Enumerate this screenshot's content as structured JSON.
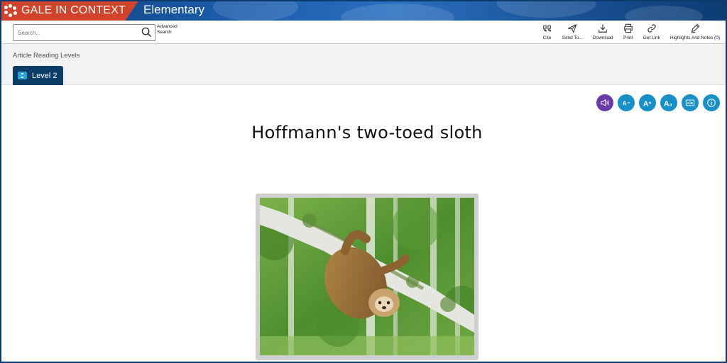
{
  "header": {
    "brand": "GALE IN CONTEXT",
    "product": "Elementary"
  },
  "toolbar": {
    "search_placeholder": "Search...",
    "advanced_search": "Advanced Search",
    "tools": [
      {
        "label": "Cite",
        "icon": "quote-icon"
      },
      {
        "label": "Send To...",
        "icon": "send-icon"
      },
      {
        "label": "Download",
        "icon": "download-icon"
      },
      {
        "label": "Print",
        "icon": "print-icon"
      },
      {
        "label": "Get Link",
        "icon": "link-icon"
      },
      {
        "label": "Highlights And Notes (0)",
        "icon": "pencil-icon"
      }
    ]
  },
  "reading_levels": {
    "title": "Article Reading Levels",
    "current": "Level 2"
  },
  "reader_controls": [
    {
      "name": "listen",
      "icon": "speaker-icon",
      "color": "#6a3aa8"
    },
    {
      "name": "decrease-text",
      "icon": "font-decrease-icon",
      "color": "#1790c8"
    },
    {
      "name": "increase-text",
      "icon": "font-increase-icon",
      "color": "#1790c8"
    },
    {
      "name": "font-style",
      "icon": "font-style-icon",
      "color": "#1790c8"
    },
    {
      "name": "dictionary",
      "icon": "dictionary-icon",
      "color": "#1790c8"
    },
    {
      "name": "info",
      "icon": "info-icon",
      "color": "#1790c8"
    }
  ],
  "article": {
    "title": "Hoffmann's two-toed sloth"
  },
  "colors": {
    "brand_red": "#d2432b",
    "banner_blue": "#1a5aa8",
    "level_tab": "#0b3d66",
    "control_blue": "#1790c8",
    "control_purple": "#6a3aa8"
  }
}
